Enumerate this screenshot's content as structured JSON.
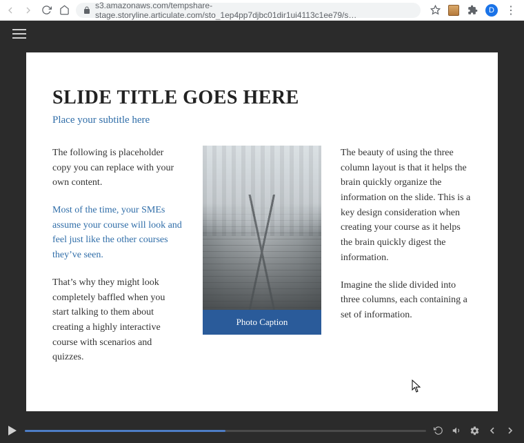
{
  "browser": {
    "url": "s3.amazonaws.com/tempshare-stage.storyline.articulate.com/sto_1ep4pp7djbc01dir1ui4113c1ee79/s…",
    "avatar": "D"
  },
  "slide": {
    "title": "SLIDE TITLE GOES HERE",
    "subtitle": "Place your subtitle here",
    "col1": {
      "p1": "The following is placeholder copy you can replace with your own content.",
      "p2": "Most of the time, your SMEs assume your course will look and feel just like the other courses they’ve seen.",
      "p3": "That’s why they might look completely baffled when you start talking to them about creating a highly interactive course with scenarios and quizzes."
    },
    "caption": "Photo Caption",
    "col3": {
      "p1": "The beauty of using the three column layout is that it helps the brain quickly organize the information on the slide. This is a key design consideration when creating your course as it helps the brain quickly digest the information.",
      "p2": "Imagine the slide divided into three columns, each containing a set of information."
    }
  }
}
